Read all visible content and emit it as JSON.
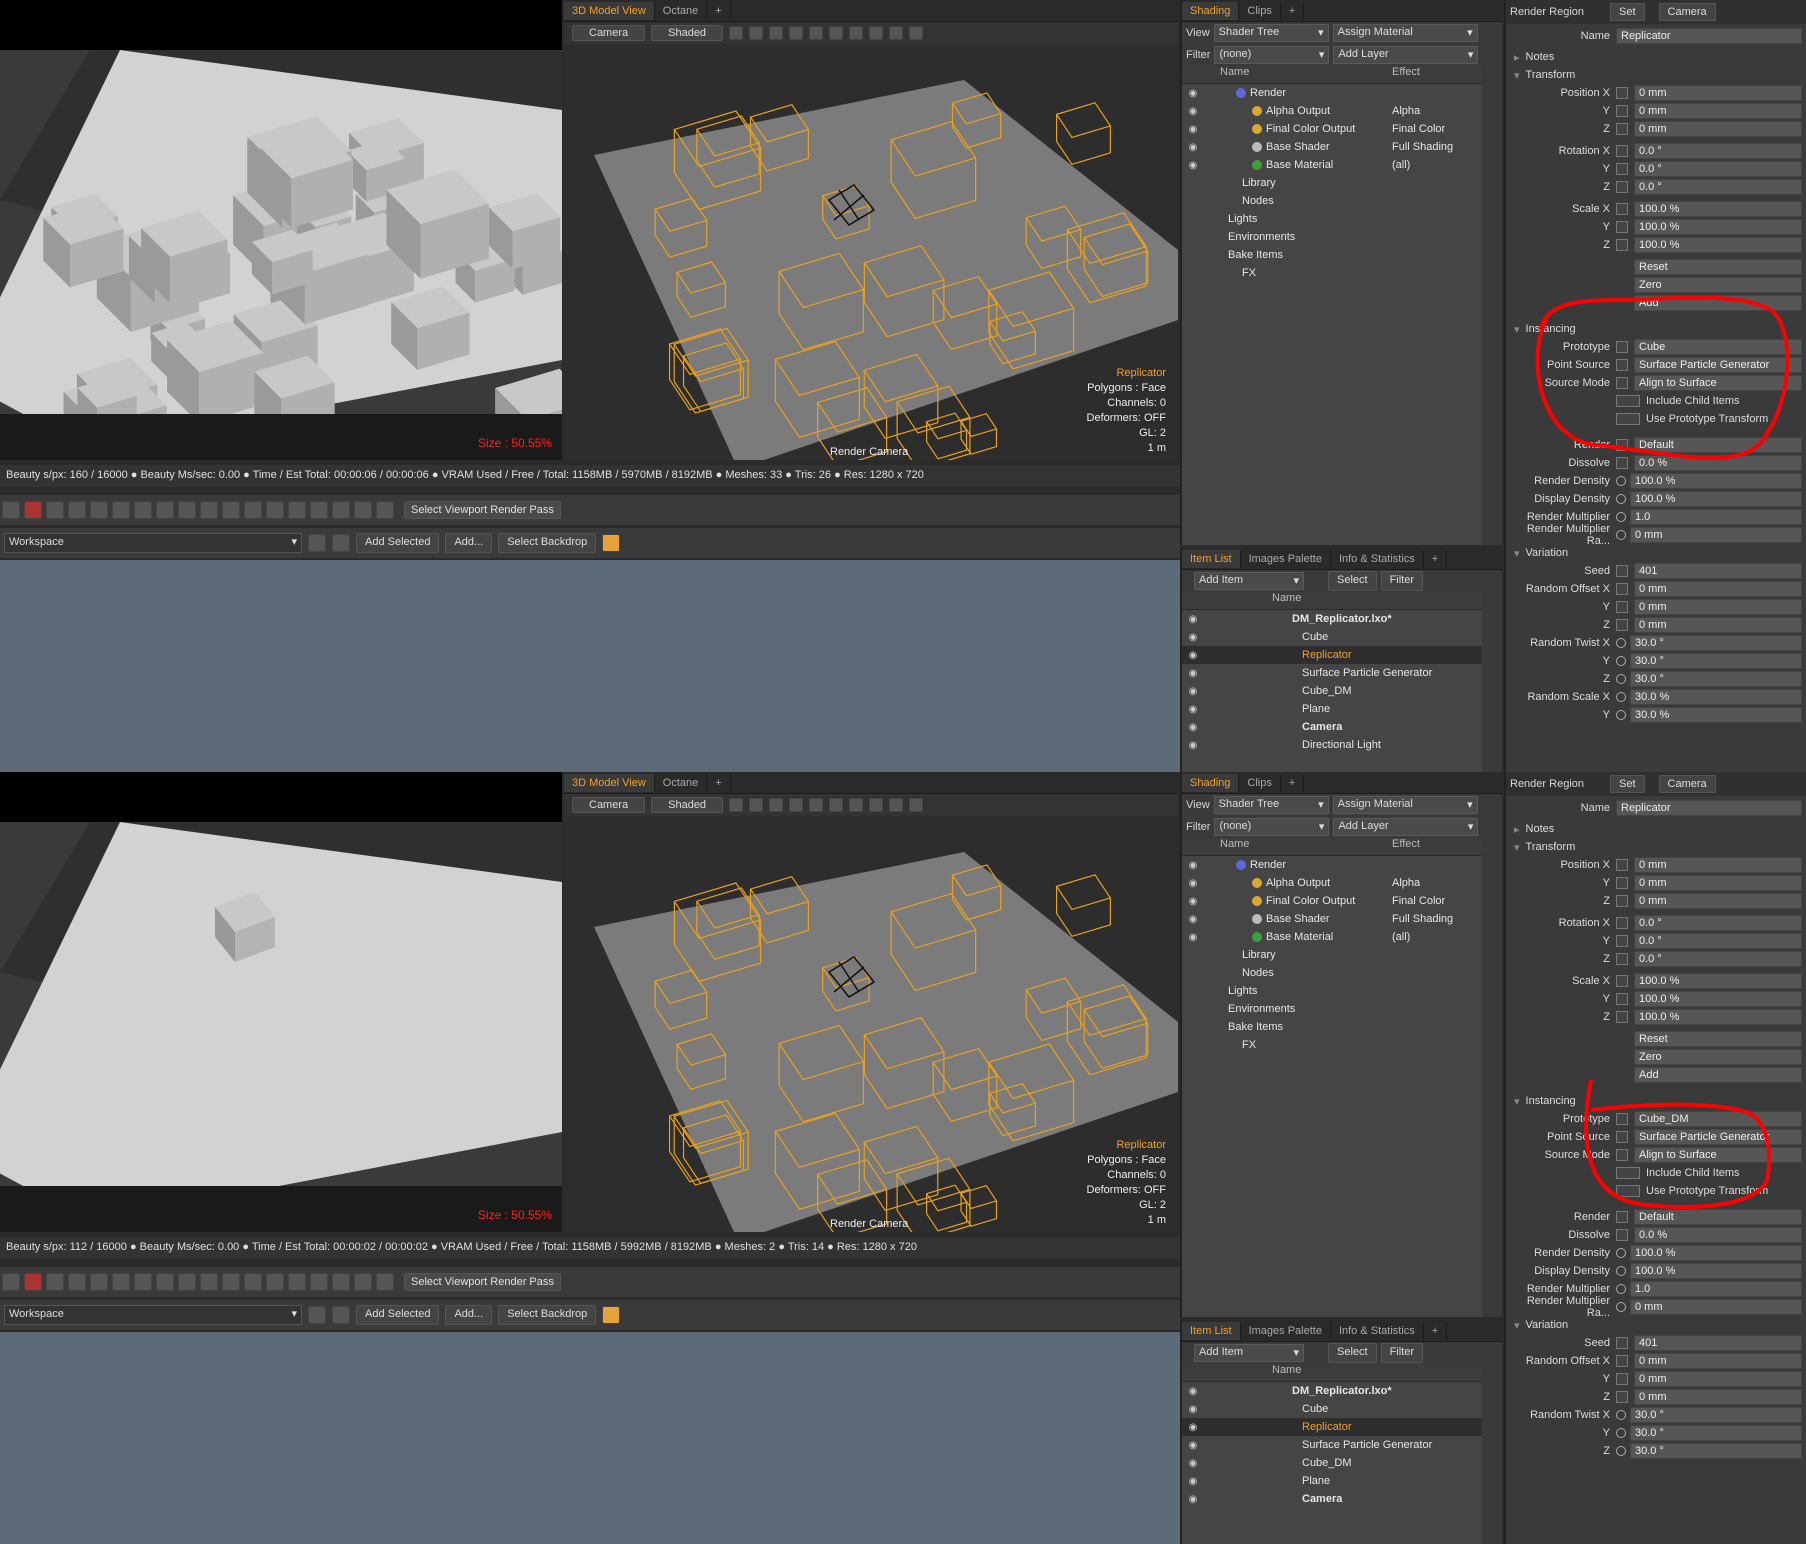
{
  "panels": [
    {
      "render": {
        "size_label": "Size : 50.55%"
      },
      "status": "Beauty s/px: 160 / 16000 ● Beauty Ms/sec: 0.00 ● Time / Est Total: 00:00:06 / 00:00:06 ● VRAM Used / Free / Total: 1158MB / 5970MB / 8192MB ● Meshes: 33 ● Tris: 26 ● Res: 1280 x 720",
      "prototype": "Cube",
      "reset_labels": [
        "Reset",
        "Zero",
        "Add"
      ],
      "item_rows": [
        "DM_Replicator.lxo*",
        "Cube",
        "Replicator",
        "Surface Particle Generator",
        "Cube_DM",
        "Plane",
        "Camera",
        "Directional Light"
      ],
      "variation_rows": [
        {
          "label": "Seed",
          "value": "401"
        },
        {
          "label": "Random Offset X",
          "value": "0 mm"
        },
        {
          "label": "Y",
          "value": "0 mm"
        },
        {
          "label": "Z",
          "value": "0 mm"
        },
        {
          "label": "Random Twist X",
          "value": "30.0 °"
        },
        {
          "label": "Y",
          "value": "30.0 °"
        },
        {
          "label": "Z",
          "value": "30.0 °"
        },
        {
          "label": "Random Scale X",
          "value": "30.0 %"
        },
        {
          "label": "Y",
          "value": "30.0 %"
        }
      ]
    },
    {
      "render": {
        "size_label": "Size : 50.55%"
      },
      "status": "Beauty s/px: 112 / 16000 ● Beauty Ms/sec: 0.00 ● Time / Est Total: 00:00:02 / 00:00:02 ● VRAM Used / Free / Total: 1158MB / 5992MB / 8192MB ● Meshes: 2 ● Tris: 14 ● Res: 1280 x 720",
      "prototype": "Cube_DM",
      "reset_labels": [
        "Reset",
        "Zero",
        "Add"
      ],
      "item_rows": [
        "DM_Replicator.lxo*",
        "Cube",
        "Replicator",
        "Surface Particle Generator",
        "Cube_DM",
        "Plane",
        "Camera"
      ],
      "variation_rows": [
        {
          "label": "Seed",
          "value": "401"
        },
        {
          "label": "Random Offset X",
          "value": "0 mm"
        },
        {
          "label": "Y",
          "value": "0 mm"
        },
        {
          "label": "Z",
          "value": "0 mm"
        },
        {
          "label": "Random Twist X",
          "value": "30.0 °"
        },
        {
          "label": "Y",
          "value": "30.0 °"
        },
        {
          "label": "Z",
          "value": "30.0 °"
        }
      ]
    }
  ],
  "common": {
    "toolbar": {
      "render_pass": "Select Viewport Render Pass"
    },
    "workspace": {
      "select": "Workspace",
      "add_selected": "Add Selected",
      "add": "Add...",
      "backdrop": "Select Backdrop"
    },
    "viewport": {
      "tabs": [
        "3D Model View",
        "Octane",
        "+"
      ],
      "camera_btn": "Camera",
      "shaded_btn": "Shaded",
      "info": [
        "Replicator",
        "Polygons : Face",
        "Channels: 0",
        "Deformers: OFF",
        "GL: 2",
        "1 m"
      ],
      "render_camera": "Render Camera"
    },
    "shading": {
      "tabs": [
        "Shading",
        "Clips",
        "+"
      ],
      "view_label": "View",
      "view_value": "Shader Tree",
      "assign": "Assign Material",
      "filter_label": "Filter",
      "filter_value": "(none)",
      "add_layer": "Add Layer",
      "col_name": "Name",
      "col_effect": "Effect",
      "rows": [
        {
          "name": "Render",
          "effect": ""
        },
        {
          "name": "Alpha Output",
          "effect": "Alpha"
        },
        {
          "name": "Final Color Output",
          "effect": "Final Color"
        },
        {
          "name": "Base Shader",
          "effect": "Full Shading"
        },
        {
          "name": "Base Material",
          "effect": "(all)"
        },
        {
          "name": "Library",
          "effect": ""
        },
        {
          "name": "Nodes",
          "effect": ""
        },
        {
          "name": "Lights",
          "effect": ""
        },
        {
          "name": "Environments",
          "effect": ""
        },
        {
          "name": "Bake Items",
          "effect": ""
        },
        {
          "name": "FX",
          "effect": ""
        }
      ]
    },
    "items": {
      "tabs": [
        "Item List",
        "Images Palette",
        "Info & Statistics",
        "+"
      ],
      "add_item": "Add Item",
      "select": "Select",
      "filter": "Filter",
      "col_name": "Name"
    },
    "props": {
      "render_region": "Render Region",
      "set": "Set",
      "camera": "Camera",
      "name_label": "Name",
      "name_value": "Replicator",
      "sections": {
        "notes": "Notes",
        "transform": "Transform",
        "instancing": "Instancing",
        "variation": "Variation"
      },
      "transform_rows": [
        {
          "label": "Position X",
          "value": "0 mm"
        },
        {
          "label": "Y",
          "value": "0 mm"
        },
        {
          "label": "Z",
          "value": "0 mm"
        },
        {
          "label": "Rotation X",
          "value": "0.0 °"
        },
        {
          "label": "Y",
          "value": "0.0 °"
        },
        {
          "label": "Z",
          "value": "0.0 °"
        },
        {
          "label": "Scale X",
          "value": "100.0 %"
        },
        {
          "label": "Y",
          "value": "100.0 %"
        },
        {
          "label": "Z",
          "value": "100.0 %"
        }
      ],
      "prototype_label": "Prototype",
      "point_source_label": "Point Source",
      "point_source_value": "Surface Particle Generator",
      "source_mode_label": "Source Mode",
      "source_mode_value": "Align to Surface",
      "include_child": "Include Child Items",
      "use_proto": "Use Prototype Transform",
      "render_rows": [
        {
          "label": "Render",
          "value": "Default"
        },
        {
          "label": "Dissolve",
          "value": "0.0 %"
        },
        {
          "label": "Render Density",
          "value": "100.0 %"
        },
        {
          "label": "Display Density",
          "value": "100.0 %"
        },
        {
          "label": "Render Multiplier",
          "value": "1.0"
        },
        {
          "label": "Render Multiplier Ra...",
          "value": "0 mm"
        }
      ]
    }
  },
  "colors": {
    "accent": "#f0a030",
    "annotation": "#ff0000",
    "wireframe": "#e8a020"
  }
}
